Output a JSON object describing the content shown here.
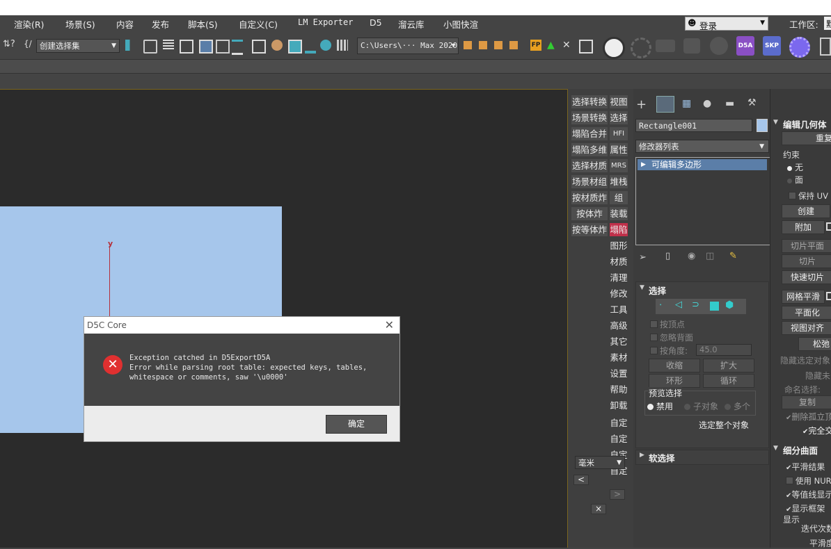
{
  "menubar": {
    "items": [
      "渲染(R)",
      "场景(S)",
      "内容",
      "发布",
      "脚本(S)",
      "自定义(C)",
      "LM Exporter",
      "D5",
      "溜云库",
      "小图快渲"
    ],
    "login": "登录",
    "workspace_label": "工作区:",
    "workspace_value": "默"
  },
  "toolbar": {
    "selection_set": "创建选择集",
    "path": "C:\\Users\\··· Max 2020",
    "d5a_label": "D5A",
    "skp_label": "SKP",
    "fp_label": "FP"
  },
  "viewport": {
    "axis_label": "y"
  },
  "dialog": {
    "title": "D5C Core",
    "message_line1": "Exception catched in D5ExportD5A",
    "message_line2": "Error while parsing root table: expected keys, tables,",
    "message_line3": "whitespace or comments, saw '\\u0000'",
    "ok_button": "确定"
  },
  "left_buttons": [
    "选择转换",
    "场景转换",
    "塌陷合并",
    "塌陷多维",
    "选择材质",
    "场景材组",
    "按材质炸",
    "按体炸",
    "按等体炸"
  ],
  "right_buttons": [
    "视图",
    "选择",
    "HFI",
    "属性",
    "MRS",
    "堆栈",
    "组",
    "装载",
    "塌陷",
    "图形",
    "材质",
    "清理",
    "修改",
    "工具",
    "高级",
    "其它",
    "素材",
    "设置",
    "帮助",
    "卸载",
    "自定",
    "自定",
    "自定",
    "自定"
  ],
  "unit": {
    "value": "毫米",
    "prev": "<",
    "next": ">",
    "close": "×"
  },
  "command_panel": {
    "object_name": "Rectangle001",
    "modifier_list": "修改器列表",
    "modifier_item": "可编辑多边形",
    "selection_header": "选择",
    "by_vertex": "按顶点",
    "ignore_backface": "忽略背面",
    "by_angle": "按角度:",
    "angle_value": "45.0",
    "shrink": "收缩",
    "grow": "扩大",
    "ring": "环形",
    "loop": "循环",
    "preview_label": "预览选择",
    "preview_off": "禁用",
    "preview_sub": "子对象",
    "preview_multi": "多个",
    "whole_object": "选定整个对象",
    "soft_selection": "软选择"
  },
  "edit_geometry": {
    "header": "编辑几何体",
    "repeat": "重复",
    "constraint": "约束",
    "none": "无",
    "face": "面",
    "preserve_uv": "保持 UV",
    "create": "创建",
    "attach": "附加",
    "slice_plane": "切片平面",
    "slice": "切片",
    "quick_slice": "快速切片",
    "mesh_smooth": "网格平滑",
    "planarize": "平面化",
    "view_align": "视图对齐",
    "relax": "松弛",
    "hide_selected": "隐藏选定对象",
    "hide_unselected": "隐藏未",
    "named_selection": "命名选择:",
    "copy": "复制",
    "delete_isolated": "删除孤立顶",
    "full_interactive": "完全交",
    "subdivision_header": "细分曲面",
    "smooth_result": "平滑结果",
    "use_nurms": "使用 NURM",
    "isoline": "等值线显示",
    "show_cage": "显示框架",
    "show": "显示",
    "iterations": "迭代次数",
    "smoothness": "平滑度"
  }
}
